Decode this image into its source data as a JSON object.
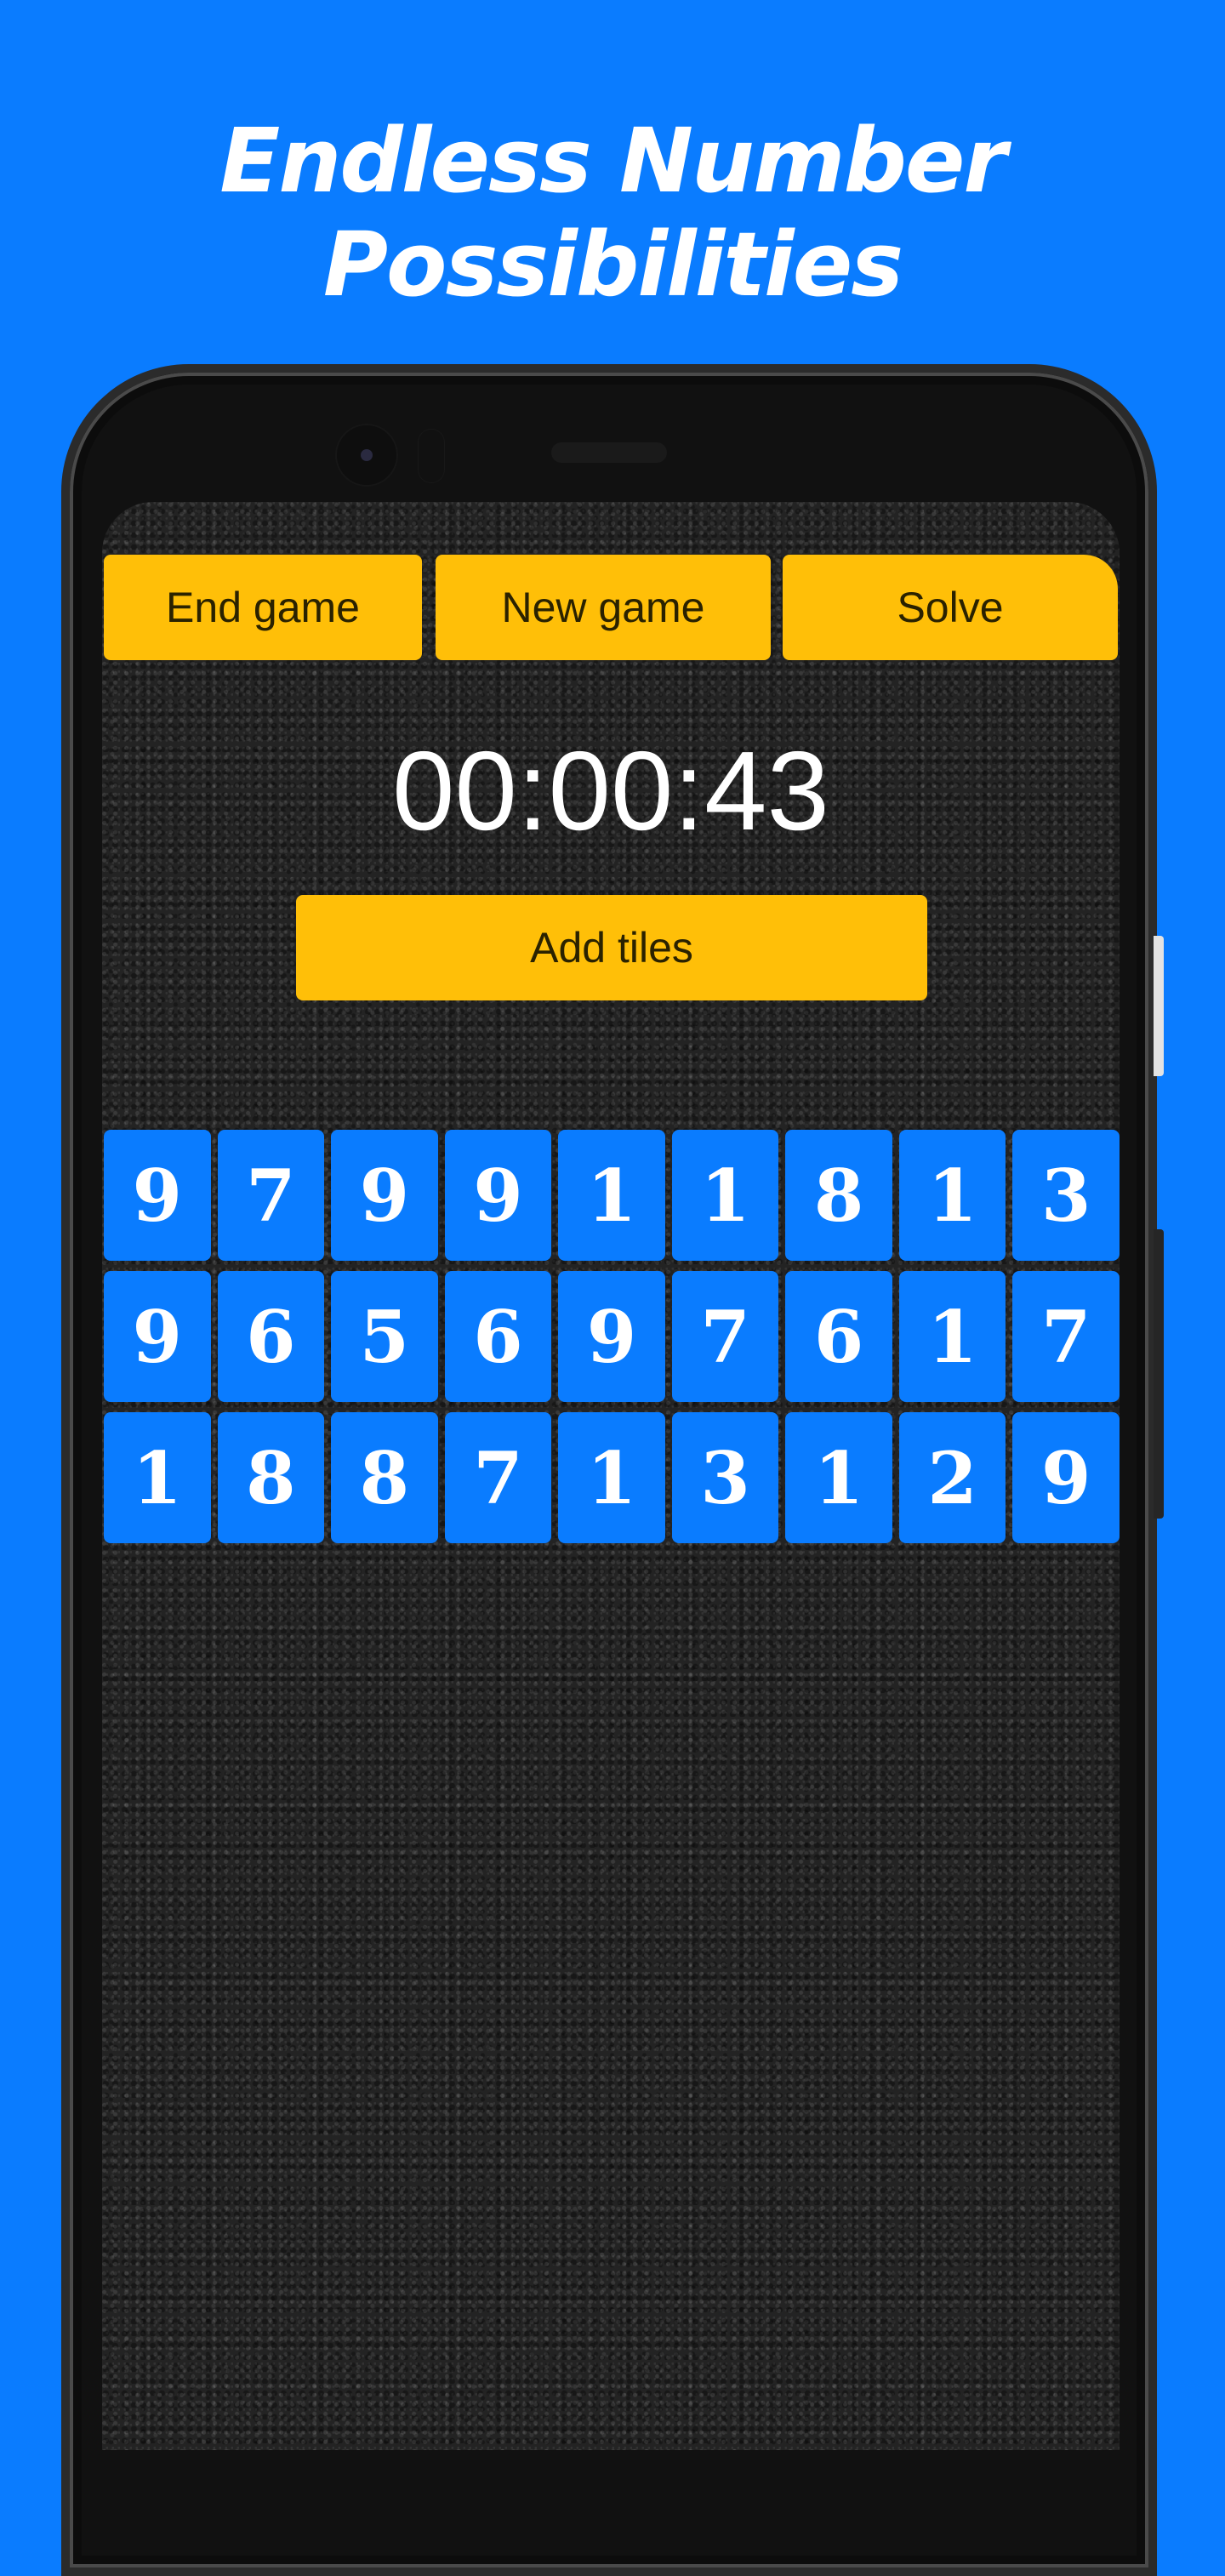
{
  "promo": {
    "headline_line1": "Endless Number",
    "headline_line2": "Possibilities",
    "background_color": "#0a7cff"
  },
  "game": {
    "toolbar": {
      "end_game_label": "End game",
      "new_game_label": "New game",
      "solve_label": "Solve"
    },
    "timer": "00:00:43",
    "add_tiles_label": "Add tiles",
    "accent_color": "#ffbf08",
    "tile_color": "#0a7cff",
    "tiles": [
      [
        "9",
        "7",
        "9",
        "9",
        "1",
        "1",
        "8",
        "1",
        "3"
      ],
      [
        "9",
        "6",
        "5",
        "6",
        "9",
        "7",
        "6",
        "1",
        "7"
      ],
      [
        "1",
        "8",
        "8",
        "7",
        "1",
        "3",
        "1",
        "2",
        "9"
      ]
    ]
  }
}
